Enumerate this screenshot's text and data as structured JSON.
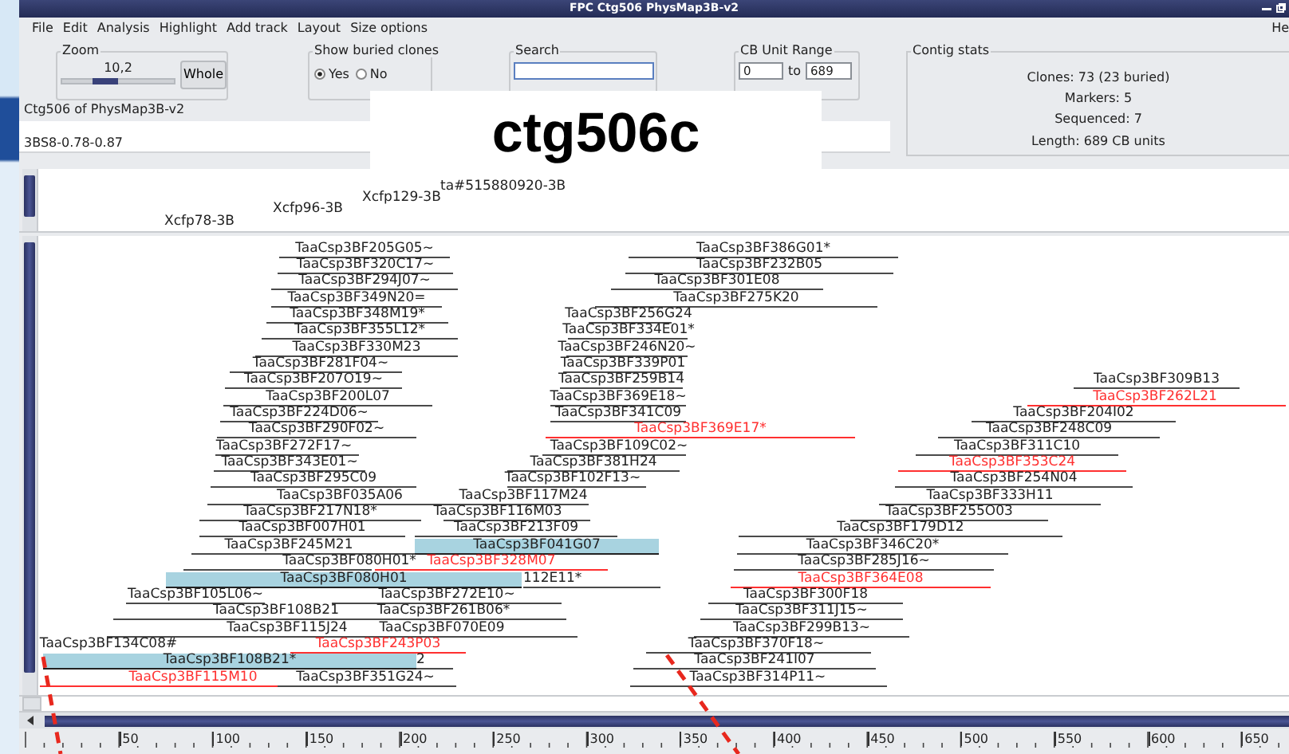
{
  "window": {
    "title": "FPC Ctg506 PhysMap3B-v2"
  },
  "menu": [
    "File",
    "Edit",
    "Analysis",
    "Highlight",
    "Add track",
    "Layout",
    "Size options",
    "He"
  ],
  "zoom": {
    "label": "Zoom",
    "value": "10,2",
    "level": 0.37,
    "button": "Whole"
  },
  "buried": {
    "label": "Show buried clones",
    "options": [
      {
        "label": "Yes",
        "selected": true
      },
      {
        "label": "No",
        "selected": false
      }
    ]
  },
  "search": {
    "label": "Search"
  },
  "cb_range": {
    "label": "CB Unit Range",
    "from": "0",
    "to_label": "to",
    "to": "689"
  },
  "contig_stats": {
    "label": "Contig stats",
    "lines": [
      "Clones: 73 (23 buried)",
      "Markers: 5",
      "Sequenced: 7",
      "Length: 689 CB units"
    ]
  },
  "contig_label": "Ctg506 of PhysMap3B-v2",
  "track_label": "3BS8-0.78-0.87",
  "overlay_title": "ctg506c",
  "markers": [
    "Xcfp78-3B",
    "Xcfp96-3B",
    "Xcfp129-3B",
    "ta#515880920-3B"
  ],
  "clones": [
    {
      "name": "TaaCsp3BF205G05~",
      "color": "#222222",
      "selected": false
    },
    {
      "name": "TaaCsp3BF386G01*",
      "color": "#222222",
      "selected": false
    },
    {
      "name": "TaaCsp3BF320C17~",
      "color": "#222222",
      "selected": false
    },
    {
      "name": "TaaCsp3BF232B05",
      "color": "#222222",
      "selected": false
    },
    {
      "name": "TaaCsp3BF294J07~",
      "color": "#222222",
      "selected": false
    },
    {
      "name": "TaaCsp3BF301E08",
      "color": "#222222",
      "selected": false
    },
    {
      "name": "TaaCsp3BF349N20=",
      "color": "#222222",
      "selected": false
    },
    {
      "name": "TaaCsp3BF275K20",
      "color": "#222222",
      "selected": false
    },
    {
      "name": "TaaCsp3BF348M19*",
      "color": "#222222",
      "selected": false
    },
    {
      "name": "TaaCsp3BF256G24",
      "color": "#222222",
      "selected": false
    },
    {
      "name": "TaaCsp3BF355L12*",
      "color": "#222222",
      "selected": false
    },
    {
      "name": "TaaCsp3BF334E01*",
      "color": "#222222",
      "selected": false
    },
    {
      "name": "TaaCsp3BF330M23",
      "color": "#222222",
      "selected": false
    },
    {
      "name": "TaaCsp3BF246N20~",
      "color": "#222222",
      "selected": false
    },
    {
      "name": "TaaCsp3BF281F04~",
      "color": "#222222",
      "selected": false
    },
    {
      "name": "TaaCsp3BF339P01",
      "color": "#222222",
      "selected": false
    },
    {
      "name": "TaaCsp3BF207O19~",
      "color": "#222222",
      "selected": false
    },
    {
      "name": "TaaCsp3BF259B14",
      "color": "#222222",
      "selected": false
    },
    {
      "name": "TaaCsp3BF309B13",
      "color": "#222222",
      "selected": false
    },
    {
      "name": "TaaCsp3BF200L07",
      "color": "#222222",
      "selected": false
    },
    {
      "name": "TaaCsp3BF369E18~",
      "color": "#222222",
      "selected": false
    },
    {
      "name": "TaaCsp3BF262L21",
      "color": "#ff3030",
      "selected": false
    },
    {
      "name": "TaaCsp3BF224D06~",
      "color": "#222222",
      "selected": false
    },
    {
      "name": "TaaCsp3BF341C09",
      "color": "#222222",
      "selected": false
    },
    {
      "name": "TaaCsp3BF204I02",
      "color": "#222222",
      "selected": false
    },
    {
      "name": "TaaCsp3BF290F02~",
      "color": "#222222",
      "selected": false
    },
    {
      "name": "TaaCsp3BF369E17*",
      "color": "#ff3030",
      "selected": false
    },
    {
      "name": "TaaCsp3BF248C09",
      "color": "#222222",
      "selected": false
    },
    {
      "name": "TaaCsp3BF272F17~",
      "color": "#222222",
      "selected": false
    },
    {
      "name": "TaaCsp3BF109C02~",
      "color": "#222222",
      "selected": false
    },
    {
      "name": "TaaCsp3BF311C10",
      "color": "#222222",
      "selected": false
    },
    {
      "name": "TaaCsp3BF343E01~",
      "color": "#222222",
      "selected": false
    },
    {
      "name": "TaaCsp3BF381H24",
      "color": "#222222",
      "selected": false
    },
    {
      "name": "TaaCsp3BF353C24",
      "color": "#ff3030",
      "selected": false
    },
    {
      "name": "TaaCsp3BF295C09",
      "color": "#222222",
      "selected": false
    },
    {
      "name": "TaaCsp3BF102F13~",
      "color": "#222222",
      "selected": false
    },
    {
      "name": "TaaCsp3BF254N04",
      "color": "#222222",
      "selected": false
    },
    {
      "name": "TaaCsp3BF035A06",
      "color": "#222222",
      "selected": false
    },
    {
      "name": "TaaCsp3BF117M24",
      "color": "#222222",
      "selected": false
    },
    {
      "name": "TaaCsp3BF333H11",
      "color": "#222222",
      "selected": false
    },
    {
      "name": "TaaCsp3BF217N18*",
      "color": "#222222",
      "selected": false
    },
    {
      "name": "TaaCsp3BF116M03",
      "color": "#222222",
      "selected": false
    },
    {
      "name": "TaaCsp3BF255O03",
      "color": "#222222",
      "selected": false
    },
    {
      "name": "TaaCsp3BF007H01",
      "color": "#222222",
      "selected": false
    },
    {
      "name": "TaaCsp3BF213F09",
      "color": "#222222",
      "selected": false
    },
    {
      "name": "TaaCsp3BF179D12",
      "color": "#222222",
      "selected": false
    },
    {
      "name": "TaaCsp3BF245M21",
      "color": "#222222",
      "selected": false
    },
    {
      "name": "TaaCsp3BF041G07",
      "color": "#222222",
      "selected": true
    },
    {
      "name": "TaaCsp3BF346C20*",
      "color": "#222222",
      "selected": false
    },
    {
      "name": "TaaCsp3BF080H01*",
      "color": "#222222",
      "selected": false
    },
    {
      "name": "TaaCsp3BF328M07",
      "color": "#ff3030",
      "selected": false
    },
    {
      "name": "TaaCsp3BF285J16~",
      "color": "#222222",
      "selected": false
    },
    {
      "name": "TaaCsp3BF080H01",
      "color": "#222222",
      "selected": true
    },
    {
      "name": "112E11*",
      "color": "#222222",
      "selected": false
    },
    {
      "name": "TaaCsp3BF364E08",
      "color": "#ff3030",
      "selected": false
    },
    {
      "name": "TaaCsp3BF105L06~",
      "color": "#222222",
      "selected": false
    },
    {
      "name": "TaaCsp3BF272E10~",
      "color": "#222222",
      "selected": false
    },
    {
      "name": "TaaCsp3BF300F18",
      "color": "#222222",
      "selected": false
    },
    {
      "name": "TaaCsp3BF108B21",
      "color": "#222222",
      "selected": false
    },
    {
      "name": "TaaCsp3BF261B06*",
      "color": "#222222",
      "selected": false
    },
    {
      "name": "TaaCsp3BF311J15~",
      "color": "#222222",
      "selected": false
    },
    {
      "name": "TaaCsp3BF115J24",
      "color": "#222222",
      "selected": false
    },
    {
      "name": "TaaCsp3BF070E09",
      "color": "#222222",
      "selected": false
    },
    {
      "name": "TaaCsp3BF299B13~",
      "color": "#222222",
      "selected": false
    },
    {
      "name": "TaaCsp3BF134C08#",
      "color": "#222222",
      "selected": false
    },
    {
      "name": "TaaCsp3BF243P03",
      "color": "#ff3030",
      "selected": false
    },
    {
      "name": "TaaCsp3BF370F18~",
      "color": "#222222",
      "selected": false
    },
    {
      "name": "TaaCsp3BF108B21*",
      "color": "#222222",
      "selected": true
    },
    {
      "name": "2",
      "color": "#222222",
      "selected": false
    },
    {
      "name": "TaaCsp3BF241I07",
      "color": "#222222",
      "selected": false
    },
    {
      "name": "TaaCsp3BF115M10",
      "color": "#ff3030",
      "selected": false
    },
    {
      "name": "TaaCsp3BF351G24~",
      "color": "#222222",
      "selected": false
    },
    {
      "name": "TaaCsp3BF314P11~",
      "color": "#222222",
      "selected": false
    }
  ],
  "ruler": [
    "50",
    "100",
    "150",
    "200",
    "250",
    "300",
    "350",
    "400",
    "450",
    "500",
    "550",
    "600",
    "650"
  ],
  "annotations": [
    {
      "kind": "dashed-line"
    },
    {
      "kind": "dashed-line"
    }
  ]
}
